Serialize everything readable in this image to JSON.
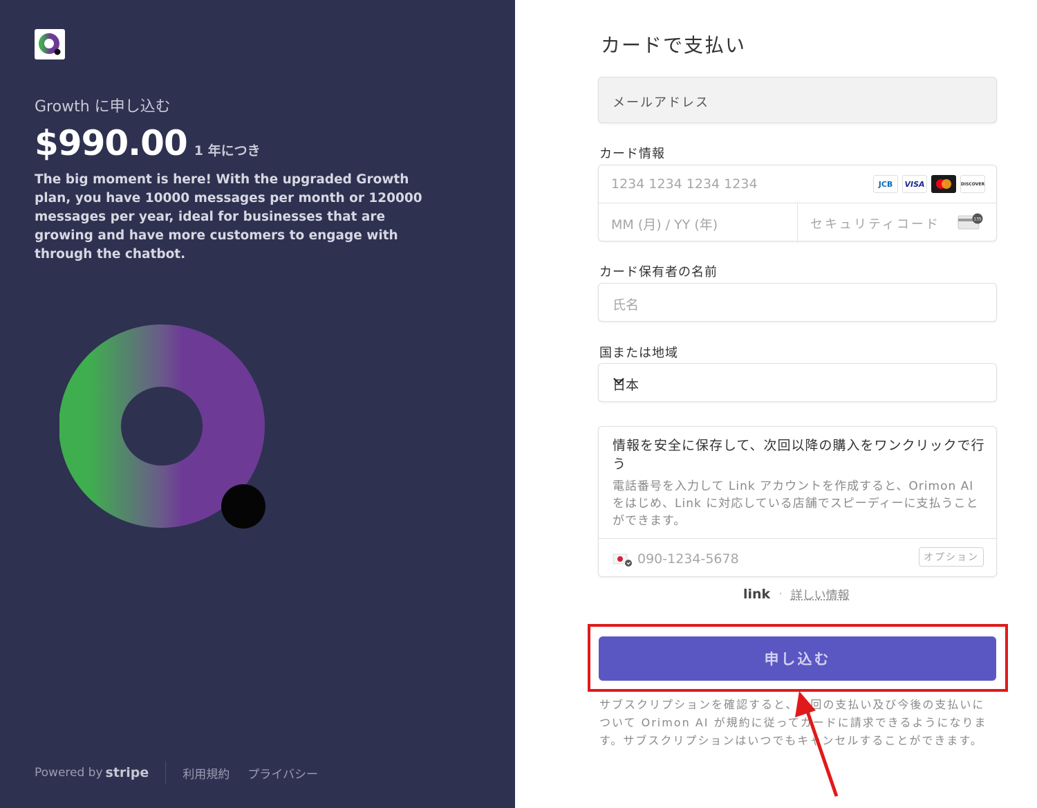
{
  "summary": {
    "product_label": "Growth に申し込む",
    "price": "$990.00",
    "period": "1 年につき",
    "description": "The big moment is here! With the upgraded Growth plan, you have 10000 messages per month or 120000 messages per year, ideal for businesses that are growing and have more customers to engage with through the chatbot."
  },
  "footer": {
    "powered_by": "Powered by",
    "stripe": "stripe",
    "terms": "利用規約",
    "privacy": "プライバシー"
  },
  "payment": {
    "title": "カードで支払い",
    "email_placeholder": "メールアドレス",
    "card_label": "カード情報",
    "card_number_placeholder": "1234 1234 1234 1234",
    "brands": [
      "JCB",
      "VISA",
      "mastercard",
      "DISCOVER"
    ],
    "expiry_placeholder": "MM (月) / YY (年)",
    "cvc_placeholder": "セキュリティコード",
    "cvc_icon_text": "135",
    "name_label": "カード保有者の名前",
    "name_placeholder": "氏名",
    "country_label": "国または地域",
    "country_value": "日本",
    "link_title": "情報を安全に保存して、次回以降の購入をワンクリックで行う",
    "link_text": "電話番号を入力して Link アカウントを作成すると、Orimon AI をはじめ、Link に対応している店舗でスピーディーに支払うことができます。",
    "phone_placeholder": "090-1234-5678",
    "optional": "オプション",
    "link_logo": "link",
    "link_more": "詳しい情報",
    "submit": "申し込む",
    "terms_text": "サブスクリプションを確認すると、今回の支払い及び今後の支払いについて Orimon AI が規約に従ってカードに請求できるようになります。サブスクリプションはいつでもキャンセルすることができます。"
  },
  "colors": {
    "left_bg": "#2e3150",
    "submit_bg": "#5b57c2",
    "highlight": "#e01a1a"
  }
}
